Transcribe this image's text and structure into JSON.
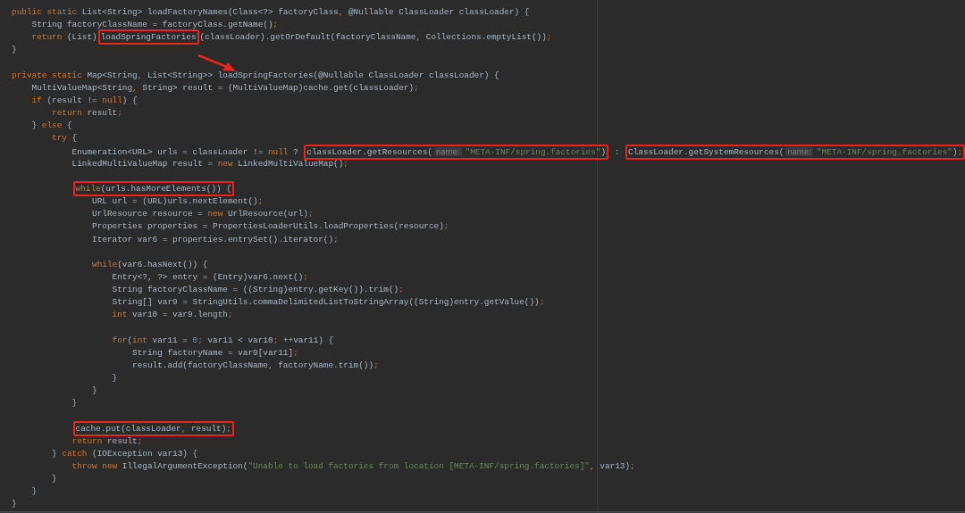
{
  "editor": {
    "blocks": [
      {
        "lines": [
          {
            "segments": [
              {
                "boxed": false,
                "tokens": [
                  {
                    "text": "public static ",
                    "kind": "keyword"
                  },
                  {
                    "text": "List<String> loadFactoryNames(Class<?> factoryClass",
                    "kind": "plain"
                  },
                  {
                    "text": ", ",
                    "kind": "punct"
                  },
                  {
                    "text": "@Nullable ClassLoader classLoader) {",
                    "kind": "plain"
                  }
                ]
              }
            ]
          },
          {
            "segments": [
              {
                "boxed": false,
                "tokens": [
                  {
                    "text": "    String factoryClassName = factoryClass.getName()",
                    "kind": "plain"
                  },
                  {
                    "text": ";",
                    "kind": "punct"
                  }
                ]
              }
            ]
          },
          {
            "segments": [
              {
                "boxed": false,
                "tokens": [
                  {
                    "text": "    return ",
                    "kind": "keyword"
                  },
                  {
                    "text": "(List)",
                    "kind": "plain"
                  }
                ]
              },
              {
                "boxed": true,
                "tokens": [
                  {
                    "text": "loadSpringFactories",
                    "kind": "plain"
                  }
                ]
              },
              {
                "boxed": false,
                "tokens": [
                  {
                    "text": "(classLoader).getOrDefault(factoryClassName",
                    "kind": "plain"
                  },
                  {
                    "text": ", ",
                    "kind": "punct"
                  },
                  {
                    "text": "Collections.emptyList())",
                    "kind": "plain"
                  },
                  {
                    "text": ";",
                    "kind": "punct"
                  }
                ]
              }
            ]
          },
          {
            "segments": [
              {
                "boxed": false,
                "tokens": [
                  {
                    "text": "}",
                    "kind": "plain"
                  }
                ]
              }
            ]
          }
        ]
      },
      {
        "lines": [
          {
            "segments": [
              {
                "boxed": false,
                "tokens": [
                  {
                    "text": "private static ",
                    "kind": "keyword"
                  },
                  {
                    "text": "Map<String",
                    "kind": "plain"
                  },
                  {
                    "text": ", ",
                    "kind": "punct"
                  },
                  {
                    "text": "List<String>> loadSpringFactories(@Nullable ClassLoader classLoader) {",
                    "kind": "plain"
                  }
                ]
              }
            ]
          },
          {
            "segments": [
              {
                "boxed": false,
                "tokens": [
                  {
                    "text": "    MultiValueMap<String",
                    "kind": "plain"
                  },
                  {
                    "text": ", ",
                    "kind": "punct"
                  },
                  {
                    "text": "String> result = (MultiValueMap)cache.get(classLoader)",
                    "kind": "plain"
                  },
                  {
                    "text": ";",
                    "kind": "punct"
                  }
                ]
              }
            ]
          },
          {
            "segments": [
              {
                "boxed": false,
                "tokens": [
                  {
                    "text": "    if ",
                    "kind": "keyword"
                  },
                  {
                    "text": "(result != ",
                    "kind": "plain"
                  },
                  {
                    "text": "null",
                    "kind": "keyword"
                  },
                  {
                    "text": ") {",
                    "kind": "plain"
                  }
                ]
              }
            ]
          },
          {
            "segments": [
              {
                "boxed": false,
                "tokens": [
                  {
                    "text": "        return ",
                    "kind": "keyword"
                  },
                  {
                    "text": "result",
                    "kind": "plain"
                  },
                  {
                    "text": ";",
                    "kind": "punct"
                  }
                ]
              }
            ]
          },
          {
            "segments": [
              {
                "boxed": false,
                "tokens": [
                  {
                    "text": "    } ",
                    "kind": "plain"
                  },
                  {
                    "text": "else ",
                    "kind": "keyword"
                  },
                  {
                    "text": "{",
                    "kind": "plain"
                  }
                ]
              }
            ]
          },
          {
            "segments": [
              {
                "boxed": false,
                "tokens": [
                  {
                    "text": "        try ",
                    "kind": "keyword"
                  },
                  {
                    "text": "{",
                    "kind": "plain"
                  }
                ]
              }
            ]
          },
          {
            "segments": [
              {
                "boxed": false,
                "tokens": [
                  {
                    "text": "            Enumeration<URL> urls = classLoader != ",
                    "kind": "plain"
                  },
                  {
                    "text": "null",
                    "kind": "keyword"
                  },
                  {
                    "text": " ? ",
                    "kind": "plain"
                  }
                ]
              },
              {
                "boxed": true,
                "tokens": [
                  {
                    "text": "classLoader.getResources(",
                    "kind": "plain"
                  },
                  {
                    "text": "name:",
                    "kind": "hint"
                  },
                  {
                    "text": "\"META-INF/spring.factories\"",
                    "kind": "string"
                  },
                  {
                    "text": ")",
                    "kind": "plain"
                  }
                ]
              },
              {
                "boxed": false,
                "tokens": [
                  {
                    "text": " : ",
                    "kind": "plain"
                  }
                ]
              },
              {
                "boxed": true,
                "tokens": [
                  {
                    "text": "ClassLoader.getSystemResources(",
                    "kind": "plain"
                  },
                  {
                    "text": "name:",
                    "kind": "hint"
                  },
                  {
                    "text": "\"META-INF/spring.factories\"",
                    "kind": "string"
                  },
                  {
                    "text": ")",
                    "kind": "plain"
                  },
                  {
                    "text": ";",
                    "kind": "punct"
                  }
                ]
              }
            ]
          },
          {
            "segments": [
              {
                "boxed": false,
                "tokens": [
                  {
                    "text": "            LinkedMultiValueMap result = ",
                    "kind": "plain"
                  },
                  {
                    "text": "new ",
                    "kind": "keyword"
                  },
                  {
                    "text": "LinkedMultiValueMap()",
                    "kind": "plain"
                  },
                  {
                    "text": ";",
                    "kind": "punct"
                  }
                ]
              }
            ]
          }
        ]
      },
      {
        "lines": [
          {
            "segments": [
              {
                "boxed": true,
                "tokens": [
                  {
                    "text": "            while",
                    "kind": "keyword"
                  },
                  {
                    "text": "(urls.hasMoreElements()) {",
                    "kind": "plain"
                  }
                ]
              }
            ]
          },
          {
            "segments": [
              {
                "boxed": false,
                "tokens": [
                  {
                    "text": "                URL url = (URL)urls.nextElement()",
                    "kind": "plain"
                  },
                  {
                    "text": ";",
                    "kind": "punct"
                  }
                ]
              }
            ]
          },
          {
            "segments": [
              {
                "boxed": false,
                "tokens": [
                  {
                    "text": "                UrlResource resource = ",
                    "kind": "plain"
                  },
                  {
                    "text": "new ",
                    "kind": "keyword"
                  },
                  {
                    "text": "UrlResource(url)",
                    "kind": "plain"
                  },
                  {
                    "text": ";",
                    "kind": "punct"
                  }
                ]
              }
            ]
          },
          {
            "segments": [
              {
                "boxed": false,
                "tokens": [
                  {
                    "text": "                Properties properties = PropertiesLoaderUtils.loadProperties(resource)",
                    "kind": "plain"
                  },
                  {
                    "text": ";",
                    "kind": "punct"
                  }
                ]
              }
            ]
          },
          {
            "segments": [
              {
                "boxed": false,
                "tokens": [
                  {
                    "text": "                Iterator var6 = properties.entrySet().iterator()",
                    "kind": "plain"
                  },
                  {
                    "text": ";",
                    "kind": "punct"
                  }
                ]
              }
            ]
          }
        ]
      },
      {
        "lines": [
          {
            "segments": [
              {
                "boxed": false,
                "tokens": [
                  {
                    "text": "                while",
                    "kind": "keyword"
                  },
                  {
                    "text": "(var6.hasNext()) {",
                    "kind": "plain"
                  }
                ]
              }
            ]
          },
          {
            "segments": [
              {
                "boxed": false,
                "tokens": [
                  {
                    "text": "                    Entry<?, ?> entry = (Entry)var6.next()",
                    "kind": "plain"
                  },
                  {
                    "text": ";",
                    "kind": "punct"
                  }
                ]
              }
            ]
          },
          {
            "segments": [
              {
                "boxed": false,
                "tokens": [
                  {
                    "text": "                    String factoryClassName = ((String)entry.getKey()).trim()",
                    "kind": "plain"
                  },
                  {
                    "text": ";",
                    "kind": "punct"
                  }
                ]
              }
            ]
          },
          {
            "segments": [
              {
                "boxed": false,
                "tokens": [
                  {
                    "text": "                    String[] var9 = StringUtils.commaDelimitedListToStringArray((String)entry.getValue())",
                    "kind": "plain"
                  },
                  {
                    "text": ";",
                    "kind": "punct"
                  }
                ]
              }
            ]
          },
          {
            "segments": [
              {
                "boxed": false,
                "tokens": [
                  {
                    "text": "                    int ",
                    "kind": "keyword"
                  },
                  {
                    "text": "var10 = var9.length",
                    "kind": "plain"
                  },
                  {
                    "text": ";",
                    "kind": "punct"
                  }
                ]
              }
            ]
          }
        ]
      },
      {
        "lines": [
          {
            "segments": [
              {
                "boxed": false,
                "tokens": [
                  {
                    "text": "                    for",
                    "kind": "keyword"
                  },
                  {
                    "text": "(",
                    "kind": "plain"
                  },
                  {
                    "text": "int ",
                    "kind": "keyword"
                  },
                  {
                    "text": "var11 = ",
                    "kind": "plain"
                  },
                  {
                    "text": "0",
                    "kind": "number"
                  },
                  {
                    "text": "; ",
                    "kind": "punct"
                  },
                  {
                    "text": "var11 < var10",
                    "kind": "plain"
                  },
                  {
                    "text": "; ",
                    "kind": "punct"
                  },
                  {
                    "text": "++var11) {",
                    "kind": "plain"
                  }
                ]
              }
            ]
          },
          {
            "segments": [
              {
                "boxed": false,
                "tokens": [
                  {
                    "text": "                        String factoryName = var9[var11]",
                    "kind": "plain"
                  },
                  {
                    "text": ";",
                    "kind": "punct"
                  }
                ]
              }
            ]
          },
          {
            "segments": [
              {
                "boxed": false,
                "tokens": [
                  {
                    "text": "                        result.add(factoryClassName",
                    "kind": "plain"
                  },
                  {
                    "text": ", ",
                    "kind": "punct"
                  },
                  {
                    "text": "factoryName.trim())",
                    "kind": "plain"
                  },
                  {
                    "text": ";",
                    "kind": "punct"
                  }
                ]
              }
            ]
          },
          {
            "segments": [
              {
                "boxed": false,
                "tokens": [
                  {
                    "text": "                    }",
                    "kind": "plain"
                  }
                ]
              }
            ]
          },
          {
            "segments": [
              {
                "boxed": false,
                "tokens": [
                  {
                    "text": "                }",
                    "kind": "plain"
                  }
                ]
              }
            ]
          },
          {
            "segments": [
              {
                "boxed": false,
                "tokens": [
                  {
                    "text": "            }",
                    "kind": "plain"
                  }
                ]
              }
            ]
          }
        ]
      },
      {
        "lines": [
          {
            "segments": [
              {
                "boxed": true,
                "tokens": [
                  {
                    "text": "            cache.put(classLoader",
                    "kind": "plain"
                  },
                  {
                    "text": ", ",
                    "kind": "punct"
                  },
                  {
                    "text": "result)",
                    "kind": "plain"
                  },
                  {
                    "text": ";",
                    "kind": "punct"
                  }
                ]
              }
            ]
          },
          {
            "segments": [
              {
                "boxed": false,
                "tokens": [
                  {
                    "text": "            return ",
                    "kind": "keyword"
                  },
                  {
                    "text": "result",
                    "kind": "plain"
                  },
                  {
                    "text": ";",
                    "kind": "punct"
                  }
                ]
              }
            ]
          },
          {
            "segments": [
              {
                "boxed": false,
                "tokens": [
                  {
                    "text": "        } ",
                    "kind": "plain"
                  },
                  {
                    "text": "catch ",
                    "kind": "keyword"
                  },
                  {
                    "text": "(IOException var13) {",
                    "kind": "plain"
                  }
                ]
              }
            ]
          },
          {
            "segments": [
              {
                "boxed": false,
                "tokens": [
                  {
                    "text": "            throw new ",
                    "kind": "keyword"
                  },
                  {
                    "text": "IllegalArgumentException(",
                    "kind": "plain"
                  },
                  {
                    "text": "\"Unable to load factories from location [META-INF/spring.factories]\"",
                    "kind": "string"
                  },
                  {
                    "text": ", ",
                    "kind": "punct"
                  },
                  {
                    "text": "var13)",
                    "kind": "plain"
                  },
                  {
                    "text": ";",
                    "kind": "punct"
                  }
                ]
              }
            ]
          },
          {
            "segments": [
              {
                "boxed": false,
                "tokens": [
                  {
                    "text": "        }",
                    "kind": "plain"
                  }
                ]
              }
            ]
          },
          {
            "segments": [
              {
                "boxed": false,
                "tokens": [
                  {
                    "text": "    }",
                    "kind": "plain"
                  }
                ]
              }
            ]
          },
          {
            "segments": [
              {
                "boxed": false,
                "tokens": [
                  {
                    "text": "}",
                    "kind": "plain"
                  }
                ]
              }
            ]
          }
        ]
      }
    ]
  }
}
